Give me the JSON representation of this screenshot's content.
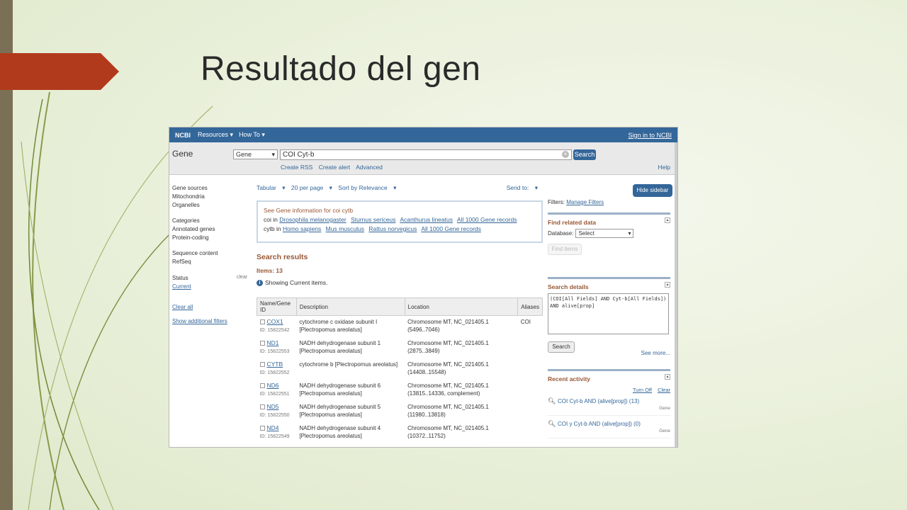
{
  "slide": {
    "title": "Resultado del gen"
  },
  "header": {
    "logo": "NCBI",
    "menu": [
      "Resources",
      "How To"
    ],
    "sign_in": "Sign in to NCBI"
  },
  "search": {
    "db_label": "Gene",
    "db_selected": "Gene",
    "query": "COI Cyt-b",
    "button": "Search",
    "sublinks": [
      "Create RSS",
      "Create alert",
      "Advanced"
    ],
    "help": "Help"
  },
  "left_sidebar": {
    "groups": [
      {
        "head": "Gene sources",
        "items": [
          "Mitochondria",
          "Organelles"
        ]
      },
      {
        "head": "Categories",
        "items": [
          "Annotated genes",
          "Protein-coding"
        ]
      },
      {
        "head": "Sequence content",
        "items": [
          "RefSeq"
        ]
      },
      {
        "head": "Status",
        "items": [
          "Current"
        ]
      }
    ],
    "clear_small": "clear",
    "clear_all": "Clear all",
    "show_filters": "Show additional filters"
  },
  "toolbar": {
    "format": "Tabular",
    "per_page": "20 per page",
    "sort": "Sort by Relevance",
    "send_to": "Send to:"
  },
  "info_box": {
    "title": "See Gene information for coi cytb",
    "row1_prefix": "coi in",
    "row1_links": [
      "Drosophila melanogaster",
      "Sturnus sericeus",
      "Acanthurus lineatus",
      "All 1000 Gene records"
    ],
    "row2_prefix": "cytb in",
    "row2_links": [
      "Homo sapiens",
      "Mus musculus",
      "Rattus norvegicus",
      "All 1000 Gene records"
    ]
  },
  "results": {
    "title": "Search results",
    "items": "Items: 13",
    "showing": "Showing Current items.",
    "columns": [
      "Name/Gene ID",
      "Description",
      "Location",
      "Aliases"
    ],
    "rows": [
      {
        "name": "COX1",
        "id": "ID: 15822542",
        "desc": "cytochrome c oxidase subunit I [Plectropomus areolatus]",
        "loc": "Chromosome MT, NC_021405.1 (5496..7046)",
        "alias": "COI"
      },
      {
        "name": "ND1",
        "id": "ID: 15822553",
        "desc": "NADH dehydrogenase subunit 1 [Plectropomus areolatus]",
        "loc": "Chromosome MT, NC_021405.1 (2875..3849)",
        "alias": ""
      },
      {
        "name": "CYTB",
        "id": "ID: 15822552",
        "desc": "cytochrome b [Plectropomus areolatus]",
        "loc": "Chromosome MT, NC_021405.1 (14408..15548)",
        "alias": ""
      },
      {
        "name": "ND6",
        "id": "ID: 15822551",
        "desc": "NADH dehydrogenase subunit 6 [Plectropomus areolatus]",
        "loc": "Chromosome MT, NC_021405.1 (13815..14336, complement)",
        "alias": ""
      },
      {
        "name": "ND5",
        "id": "ID: 15822550",
        "desc": "NADH dehydrogenase subunit 5 [Plectropomus areolatus]",
        "loc": "Chromosome MT, NC_021405.1 (11980..13818)",
        "alias": ""
      },
      {
        "name": "ND4",
        "id": "ID: 15822549",
        "desc": "NADH dehydrogenase subunit 4 [Plectropomus areolatus]",
        "loc": "Chromosome MT, NC_021405.1 (10372..11752)",
        "alias": ""
      }
    ]
  },
  "right_sidebar": {
    "hide": "Hide sidebar >>",
    "filters_label": "Filters:",
    "manage_filters": "Manage Filters",
    "find_related": "Find related data",
    "database_label": "Database:",
    "database_value": "Select",
    "find_items": "Find items",
    "search_details": "Search details",
    "query_text": "(COI[All Fields] AND Cyt-b[All Fields]) AND alive[prop]",
    "search_btn": "Search",
    "see_more": "See more...",
    "recent_activity": "Recent activity",
    "turn_off": "Turn Off",
    "clear": "Clear",
    "activity": [
      {
        "text": "COI Cyt-b AND (alive[prop]) (13)",
        "source": "Gene"
      },
      {
        "text": "COI y Cyt-b AND (alive[prop]) (0)",
        "source": "Gene"
      }
    ]
  },
  "colors": {
    "ncbi_blue": "#336699",
    "title_arrow": "#b23a1c",
    "left_bar": "#7a7056",
    "heading_brown": "#985735"
  }
}
